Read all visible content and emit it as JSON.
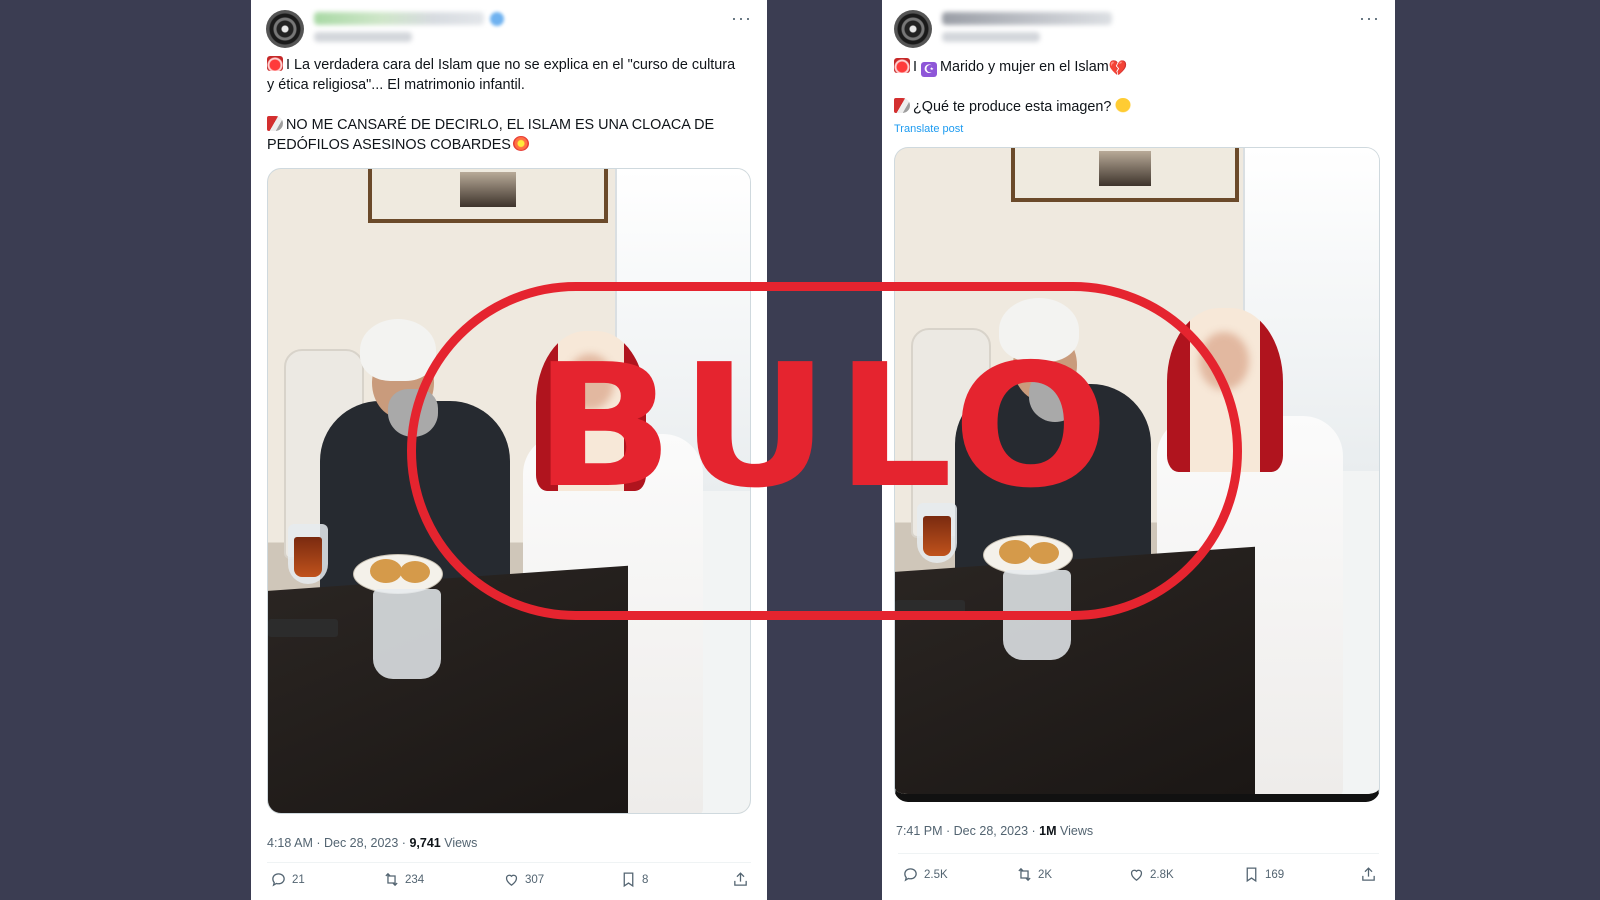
{
  "colors": {
    "page_background": "#3b3d52",
    "stamp": "#e5242f",
    "link": "#1d9bf0",
    "muted": "#536471",
    "text": "#0f1419"
  },
  "icons": {
    "more": "more-horizontal-icon",
    "reply": "reply-icon",
    "repost": "repost-icon",
    "like": "heart-icon",
    "bookmark": "bookmark-icon",
    "share": "share-icon"
  },
  "stamp": {
    "text": "BULO"
  },
  "left_tweet": {
    "more_label": "···",
    "text_lines": [
      "I La verdadera cara del Islam que no se explica en el \"curso de cultura",
      "y ética religiosa\"... El matrimonio infantil.",
      "",
      "NO ME CANSARÉ DE DECIRLO, EL ISLAM ES UNA CLOACA DE",
      "PEDÓFILOS ASESINOS COBARDES"
    ],
    "time": "4:18 AM · Dec 28, 2023 · ",
    "views_count": "9,741",
    "views_label": " Views",
    "replies": "21",
    "reposts": "234",
    "likes": "307",
    "bookmarks": "8"
  },
  "right_tweet": {
    "more_label": "···",
    "line1": "Marido y mujer en el Islam",
    "line2": "¿Qué te produce esta imagen?",
    "translate": "Translate post",
    "time": "7:41 PM · Dec 28, 2023 · ",
    "views_count": "1M",
    "views_label": " Views",
    "replies": "2.5K",
    "reposts": "2K",
    "likes": "2.8K",
    "bookmarks": "169"
  }
}
